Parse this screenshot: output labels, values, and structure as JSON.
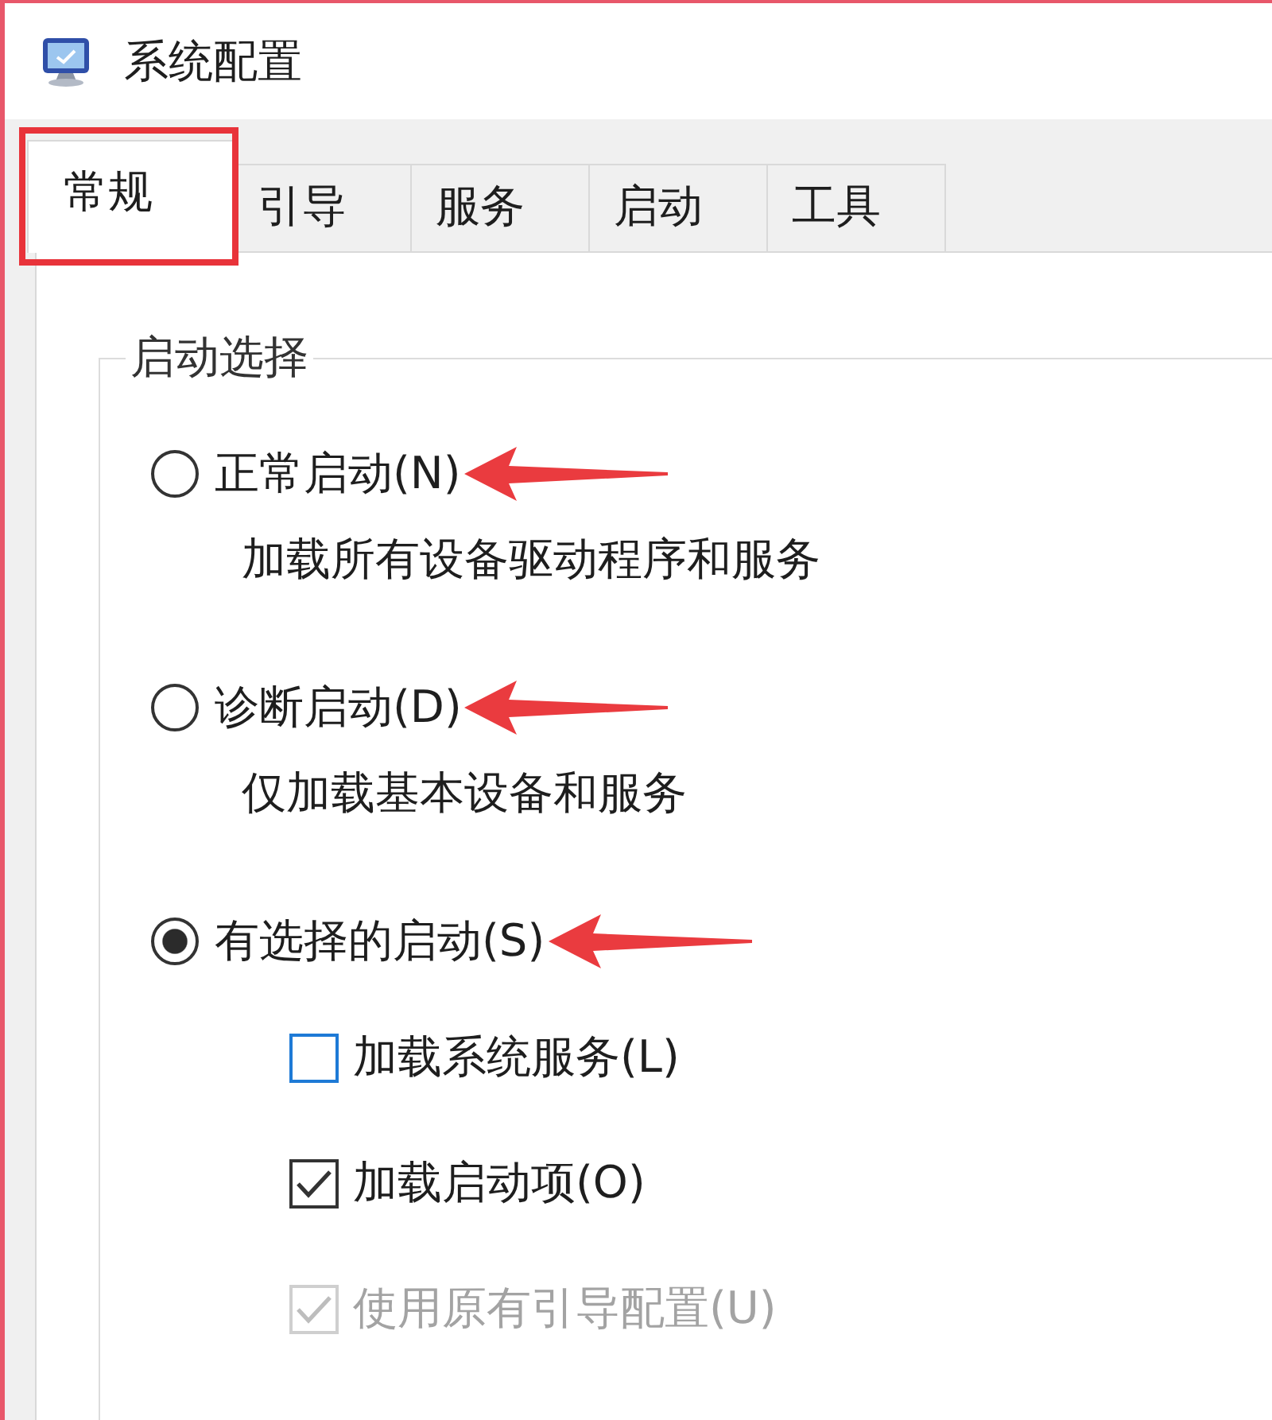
{
  "window": {
    "title": "系统配置"
  },
  "tabs": [
    {
      "label": "常规",
      "selected": true,
      "highlighted": true
    },
    {
      "label": "引导",
      "selected": false,
      "highlighted": false
    },
    {
      "label": "服务",
      "selected": false,
      "highlighted": false
    },
    {
      "label": "启动",
      "selected": false,
      "highlighted": false
    },
    {
      "label": "工具",
      "selected": false,
      "highlighted": false
    }
  ],
  "startup_selection": {
    "legend": "启动选择",
    "options": [
      {
        "label": "正常启动(N)",
        "selected": false,
        "annotated": true,
        "description": "加载所有设备驱动程序和服务"
      },
      {
        "label": "诊断启动(D)",
        "selected": false,
        "annotated": true,
        "description": "仅加载基本设备和服务"
      },
      {
        "label": "有选择的启动(S)",
        "selected": true,
        "annotated": true,
        "checkboxes": [
          {
            "label": "加载系统服务(L)",
            "checked": false,
            "focused": true,
            "disabled": false
          },
          {
            "label": "加载启动项(O)",
            "checked": true,
            "focused": false,
            "disabled": false
          },
          {
            "label": "使用原有引导配置(U)",
            "checked": true,
            "focused": false,
            "disabled": true
          }
        ]
      }
    ]
  }
}
